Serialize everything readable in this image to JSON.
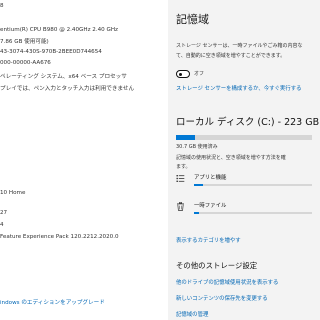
{
  "system_info": {
    "rows": [
      {
        "value": "8"
      },
      {
        "value": "entium(R) CPU B980 @ 2.40GHz   2.40 GHz"
      },
      {
        "value": "7.86 GB 使用可能)"
      },
      {
        "value": "43-3074-430S-970B-2BEE0D744654"
      },
      {
        "value": "000-00000-AA676"
      },
      {
        "value": "ペレーティング システム、x64 ベース プロセッサ"
      },
      {
        "value": "プレイでは、ペン入力とタッチ入力は利用できません"
      },
      {
        "value": "10 Home"
      },
      {
        "value": "27"
      },
      {
        "value": "4"
      },
      {
        "value": "Feature Experience Pack 120.2212.2020.0"
      }
    ],
    "upgrade_link": "indows のエディションをアップグレード"
  },
  "storage": {
    "title": "記憶域",
    "sense_desc_1": "ストレージ センサーは、一時ファイルやごみ箱の内容な",
    "sense_desc_2": "て、自動的に空き領域を増やすことができます。",
    "toggle_label": "オフ",
    "toggle_on": false,
    "configure_link": "ストレージ センサーを構成するか、今すぐ実行する",
    "disk_title": "ローカル ディスク (C:) - 223 GB",
    "disk_used_text": "30.7 GB 使用済み",
    "disk_used_fraction": 0.14,
    "disk_desc_1": "記憶域の使用状況と、空き領域を増やす方法を確",
    "disk_desc_2": "ます。",
    "items": [
      {
        "label": "アプリと機能",
        "icon": "apps-list-icon",
        "used_fraction": 0.08
      },
      {
        "label": "一時ファイル",
        "icon": "trash-icon",
        "used_fraction": 0.04
      }
    ],
    "more_categories_link": "表示するカテゴリを増やす",
    "other_title": "その他のストレージ設定",
    "other_links": [
      "他のドライブの記憶域使用状況を表示する",
      "新しいコンテンツの保存先を変更する",
      "記憶域の管理"
    ]
  },
  "colors": {
    "accent": "#0078d4",
    "link": "#0066b4",
    "track": "#d6d6d6"
  }
}
